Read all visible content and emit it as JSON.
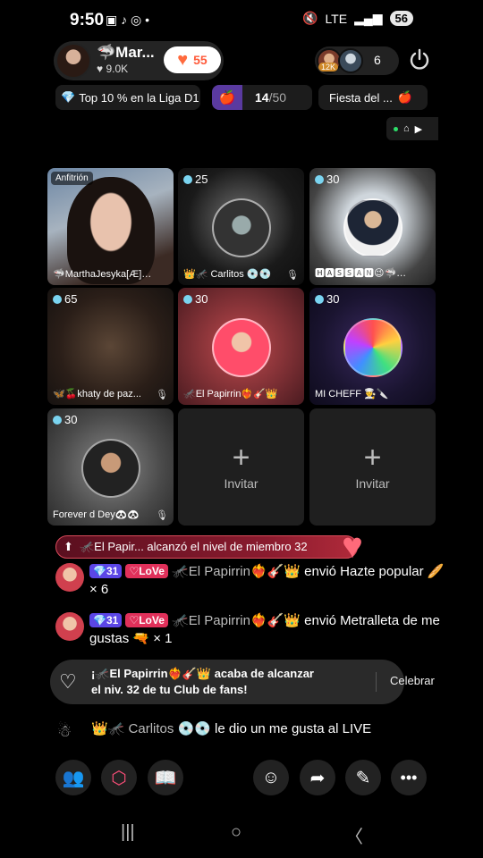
{
  "status_bar": {
    "time": "9:50",
    "notif_icons": "▣ ♪ ◎ •",
    "network": "LTE",
    "battery": "56"
  },
  "host": {
    "name": "Mar...",
    "likes": "9.0K",
    "heart_count": "55",
    "name_prefix": "🦈"
  },
  "viewers": {
    "badge": "12K",
    "count": "6"
  },
  "pills": {
    "league": "Top 10 % en la Liga D1",
    "progress_value": "14",
    "progress_total": "/50",
    "event": "Fiesta del ..."
  },
  "grid": [
    {
      "tag": "Anfitrión",
      "label": "🦈MarthaJesyka[Æ]🦟..."
    },
    {
      "count": "25",
      "label": "👑🦟 Carlitos 💿💿"
    },
    {
      "count": "30",
      "label": "🅷🅰🆂🆂🅰🅽😉🦈🎮..."
    },
    {
      "count": "65",
      "label": "🦋🍒khaty de paz..."
    },
    {
      "count": "30",
      "label": "🦟El Papirrin❤️‍🔥🎸👑"
    },
    {
      "count": "30",
      "label": "MI CHEFF 👨‍🍳🔪"
    },
    {
      "count": "30",
      "label": "Forever d Dey🐼🐼"
    },
    {
      "invite": "Invitar"
    },
    {
      "invite": "Invitar"
    }
  ],
  "level_banner": "🦟El Papir... alcanzó el nivel de miembro 32",
  "chat": [
    {
      "level": "💎31",
      "club": "♡LoVe",
      "user": "🦟El Papirrin❤️‍🔥🎸👑",
      "text": " envió Hazte popular 🥖 × 6"
    },
    {
      "level": "💎31",
      "club": "♡LoVe",
      "user": "🦟El Papirrin❤️‍🔥🎸👑",
      "text": " envió Metralleta de me gustas 🔫 × 1"
    }
  ],
  "fanclub": {
    "text": "¡🦟El Papirrin❤️‍🔥🎸👑 acaba de alcanzar el niv. 32 de tu Club de fans!",
    "action": "Celebrar"
  },
  "like_msg": {
    "user": "👑🦟 Carlitos 💿💿",
    "text": " le dio un me gusta al LIVE"
  },
  "colors": {
    "accent": "#ff4f7a",
    "level_badge": "#5b46e6",
    "club_badge": "#e0305a"
  }
}
